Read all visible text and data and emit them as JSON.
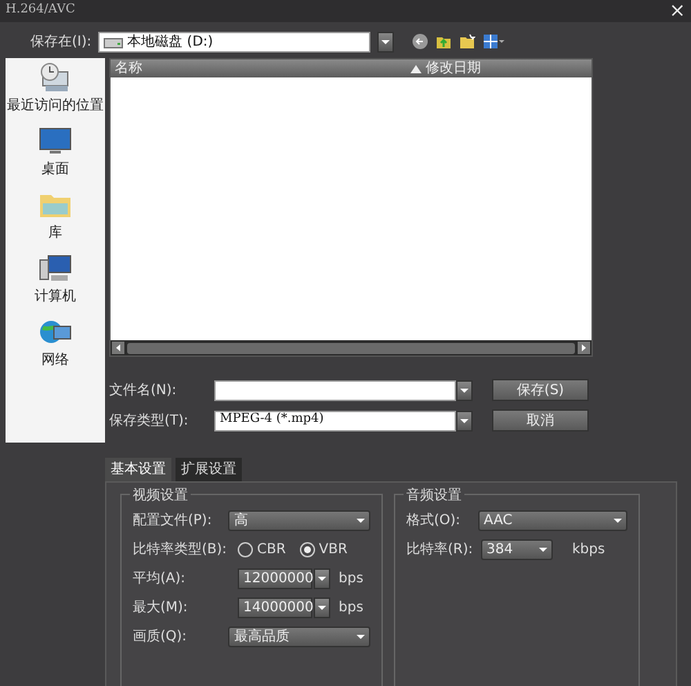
{
  "window": {
    "title": "H.264/AVC",
    "close": "×"
  },
  "save_in": {
    "label": "保存在(I):",
    "value": "本地磁盘 (D:)"
  },
  "places": [
    {
      "label": "最近访问的位置",
      "kind": "recent"
    },
    {
      "label": "桌面",
      "kind": "desktop"
    },
    {
      "label": "库",
      "kind": "library"
    },
    {
      "label": "计算机",
      "kind": "computer"
    },
    {
      "label": "网络",
      "kind": "network"
    }
  ],
  "file_list": {
    "columns": [
      {
        "label": "名称",
        "sorted": false
      },
      {
        "label": "修改日期",
        "sorted": true
      }
    ]
  },
  "file_name": {
    "label": "文件名(N):"
  },
  "save_type": {
    "label": "保存类型(T):",
    "value": "MPEG-4 (*.mp4)"
  },
  "buttons": [
    "保存(S)",
    "取消"
  ],
  "tabs": [
    {
      "label": "基本设置",
      "selected": true
    },
    {
      "label": "扩展设置",
      "selected": false
    }
  ],
  "video": {
    "title": "视频设置",
    "rows": [
      {
        "kind": "select",
        "label": "配置文件(P):",
        "value": "高"
      },
      {
        "kind": "radio",
        "label": "比特率类型(B):",
        "options": [
          {
            "label": "CBR",
            "selected": false
          },
          {
            "label": "VBR",
            "selected": true
          }
        ]
      },
      {
        "kind": "spin",
        "label": "平均(A):",
        "value": "12000000",
        "unit": "bps"
      },
      {
        "kind": "spin",
        "label": "最大(M):",
        "value": "14000000",
        "unit": "bps"
      },
      {
        "kind": "select",
        "label": "画质(Q):",
        "value": "最高品质"
      }
    ]
  },
  "audio": {
    "title": "音频设置",
    "rows": [
      {
        "kind": "select",
        "label": "格式(O):",
        "value": "AAC"
      },
      {
        "kind": "short",
        "label": "比特率(R):",
        "value": "384",
        "unit": "kbps"
      }
    ]
  }
}
